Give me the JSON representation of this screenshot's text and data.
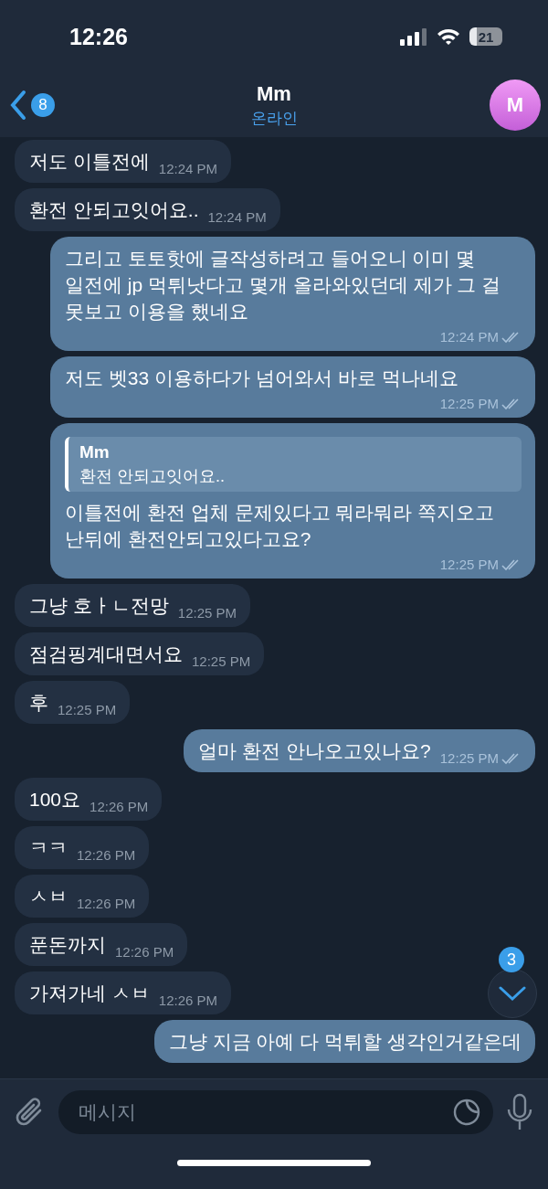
{
  "status_bar": {
    "time": "12:26",
    "battery": "21"
  },
  "header": {
    "back_badge": "8",
    "title": "Mm",
    "subtitle": "온라인",
    "avatar": "M"
  },
  "messages": [
    {
      "kind": "incoming",
      "text": "저도 이틀전에",
      "time": "12:24 PM"
    },
    {
      "kind": "incoming",
      "text": "환전 안되고잇어요..",
      "time": "12:24 PM"
    },
    {
      "kind": "outgoing",
      "text": "그리고 토토핫에 글작성하려고 들어오니 이미 몇 일전에 jp 먹튀낫다고 몇개 올라와있던데 제가 그 걸 못보고 이용을 했네요",
      "time": "12:24 PM",
      "read": true
    },
    {
      "kind": "outgoing",
      "text": "저도 벳33 이용하다가 넘어와서 바로 먹나네요",
      "time": "12:25 PM",
      "read": true
    },
    {
      "kind": "outgoing",
      "reply": {
        "name": "Mm",
        "text": "환전 안되고잇어요.."
      },
      "text": "이틀전에 환전 업체 문제있다고 뭐라뭐라 쪽지오고 난뒤에 환전안되고있다고요?",
      "time": "12:25 PM",
      "read": true
    },
    {
      "kind": "incoming",
      "text": "그냥 호ㅏㄴ전망",
      "time": "12:25 PM"
    },
    {
      "kind": "incoming",
      "text": "점검핑계대면서요",
      "time": "12:25 PM"
    },
    {
      "kind": "incoming",
      "text": "후",
      "time": "12:25 PM"
    },
    {
      "kind": "outgoing",
      "text": "얼마 환전 안나오고있나요?",
      "time": "12:25 PM",
      "read": true
    },
    {
      "kind": "incoming",
      "text": "100요",
      "time": "12:26 PM"
    },
    {
      "kind": "incoming",
      "text": "ㅋㅋ",
      "time": "12:26 PM"
    },
    {
      "kind": "incoming",
      "text": "ㅅㅂ",
      "time": "12:26 PM"
    },
    {
      "kind": "incoming",
      "text": "푼돈까지",
      "time": "12:26 PM"
    },
    {
      "kind": "incoming",
      "text": "가져가네 ㅅㅂ",
      "time": "12:26 PM"
    },
    {
      "kind": "outgoing",
      "text": "그냥 지금 아예 다 먹튀할 생각인거같은데"
    }
  ],
  "scroll_button": {
    "badge": "3"
  },
  "composer": {
    "placeholder": "메시지"
  }
}
